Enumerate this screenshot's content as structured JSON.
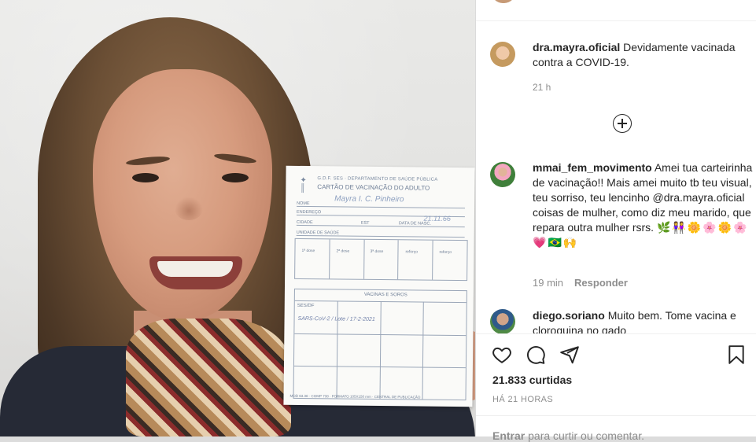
{
  "photo": {
    "card": {
      "header_line1": "G.D.F. SES · DEPARTAMENTO DE SAÚDE PÚBLICA",
      "header_line2": "CARTÃO DE VACINAÇÃO DO ADULTO",
      "field_name": "NOME",
      "field_name_value": "Mayra I. C. Pinheiro",
      "field_address": "ENDEREÇO",
      "field_city": "CIDADE",
      "field_state": "EST",
      "field_birth": "DATA DE NASC.",
      "field_birth_value": "21.11.66",
      "field_unit": "UNIDADE DE SAÚDE",
      "dose_labels": [
        "1ª dose",
        "2ª dose",
        "3ª dose",
        "reforço",
        "reforço"
      ],
      "vaccines_title": "VACINAS E SOROS",
      "ses_label": "SES/DF",
      "scribble": "SARS-CoV-2 / Lote / 17-2-2021",
      "footer": "MOD 63.38 · COMP 738 · FORMATO 105X150 mm · CENTRAL DE PUBLICAÇÃO"
    }
  },
  "post": {
    "caption": {
      "username": "dra.mayra.oficial",
      "text": "Devidamente vacinada contra a COVID-19.",
      "time": "21 h"
    },
    "load_more_icon": "plus-circle-icon",
    "comments": [
      {
        "username": "mmai_fem_movimento",
        "text": "Amei tua carteirinha de vacinação!! Mais amei muito tb teu visual, teu sorriso, teu lencinho @dra.mayra.oficial coisas de mulher, como diz meu marido, que repara outra mulher rsrs.",
        "emojis": [
          "🌿",
          "👭",
          "🌼",
          "🌸",
          "🌼",
          "🌸",
          "💗",
          "🇧🇷",
          "🙌"
        ],
        "time": "19 min",
        "reply_label": "Responder"
      },
      {
        "username": "diego.soriano",
        "text": "Muito bem. Tome vacina e cloroquina no gado"
      }
    ],
    "actions": {
      "like_icon": "heart-icon",
      "comment_icon": "comment-icon",
      "share_icon": "send-icon",
      "save_icon": "bookmark-icon"
    },
    "likes": "21.833 curtidas",
    "timestamp": "HÁ 21 HORAS",
    "add_comment": {
      "login": "Entrar",
      "rest": " para curtir ou comentar."
    }
  }
}
